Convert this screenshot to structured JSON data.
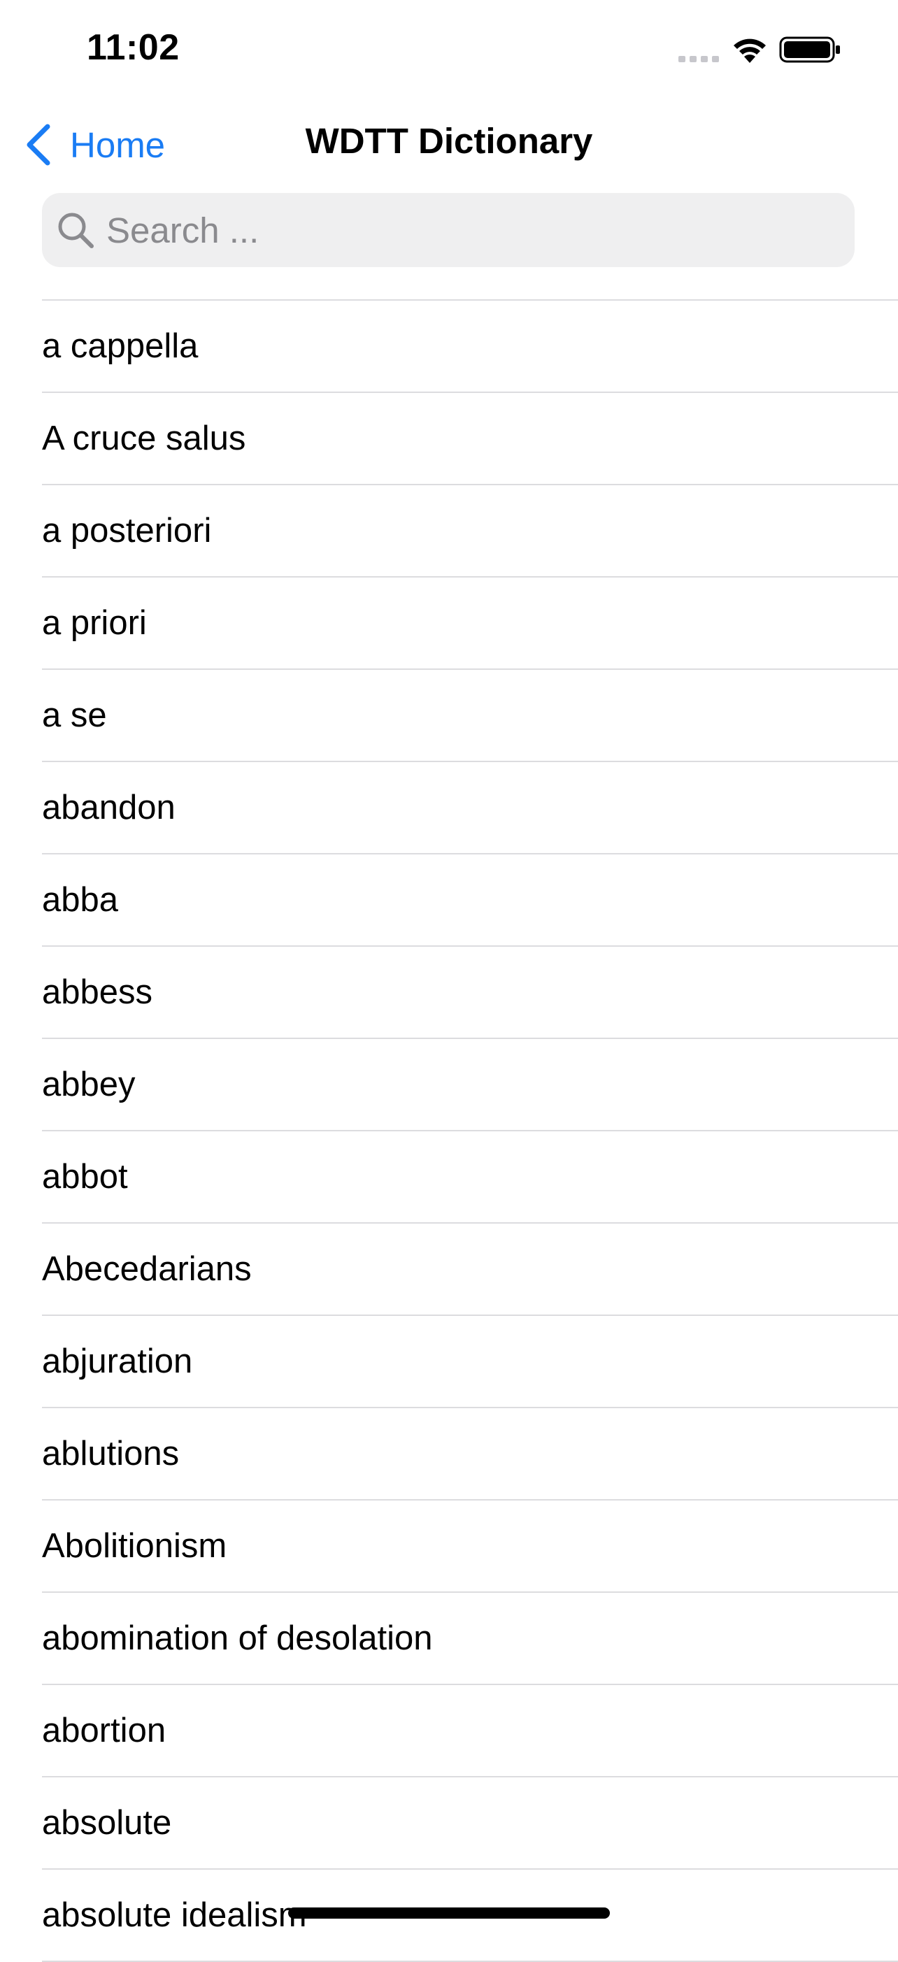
{
  "status_bar": {
    "time": "11:02"
  },
  "nav": {
    "back_label": "Home",
    "title": "WDTT Dictionary"
  },
  "search": {
    "placeholder": "Search ...",
    "value": ""
  },
  "terms": [
    "a cappella",
    "A cruce salus",
    "a posteriori",
    "a priori",
    "a se",
    "abandon",
    "abba",
    "abbess",
    "abbey",
    "abbot",
    "Abecedarians",
    "abjuration",
    "ablutions",
    "Abolitionism",
    "abomination of desolation",
    "abortion",
    "absolute",
    "absolute idealism"
  ],
  "colors": {
    "accent": "#1a7cf4",
    "search_bg": "#efeff0",
    "separator": "#dcdcdf"
  }
}
